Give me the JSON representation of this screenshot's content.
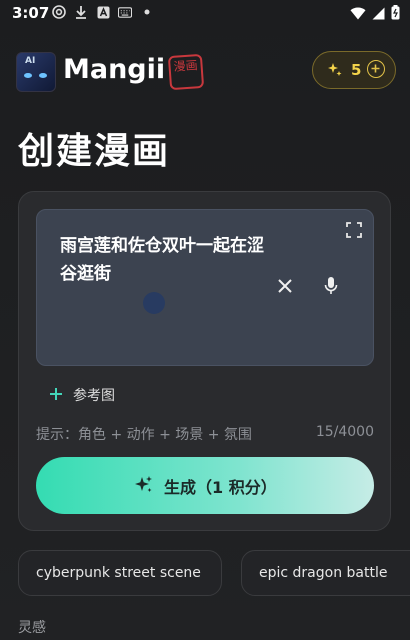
{
  "status_bar": {
    "time": "3:07"
  },
  "header": {
    "app_name": "Mangii",
    "stamp_text": "漫画",
    "credits": "5"
  },
  "page_title": "创建漫画",
  "prompt": {
    "text": "雨宫莲和佐仓双叶一起在涩谷逛街"
  },
  "reference": {
    "label": "参考图"
  },
  "hint": {
    "text": "提示：角色 + 动作 + 场景 + 氛围",
    "char_count": "15/4000"
  },
  "generate_button": {
    "label": "生成（1 积分）"
  },
  "suggestions": [
    "cyberpunk street scene",
    "epic dragon battle"
  ],
  "inspiration_label": "灵感",
  "colors": {
    "accent": "#34dcb2",
    "credits_gold": "#f3d34a",
    "stamp_red": "#c8383d"
  }
}
